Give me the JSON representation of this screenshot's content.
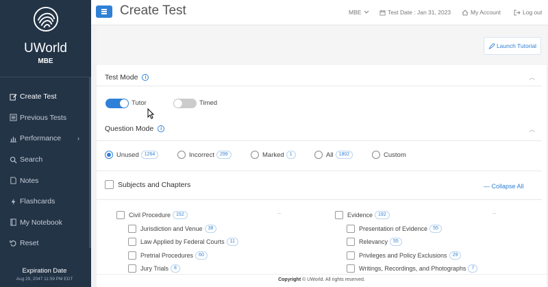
{
  "sidebar": {
    "brand": "UWorld",
    "subtitle": "MBE",
    "items": [
      {
        "label": "Create Test",
        "icon": "edit-icon"
      },
      {
        "label": "Previous Tests",
        "icon": "list-icon"
      },
      {
        "label": "Performance",
        "icon": "bar-chart-icon"
      },
      {
        "label": "Search",
        "icon": "search-icon"
      },
      {
        "label": "Notes",
        "icon": "note-icon"
      },
      {
        "label": "Flashcards",
        "icon": "bolt-icon"
      },
      {
        "label": "My Notebook",
        "icon": "notebook-icon"
      },
      {
        "label": "Reset",
        "icon": "reset-icon"
      }
    ],
    "expiration_label": "Expiration Date",
    "expiration_date": "Aug 29, 2047 11:59 PM EDT"
  },
  "header": {
    "title": "Create Test",
    "exam_select": "MBE",
    "test_date": "Test Date : Jan 31, 2023",
    "my_account": "My Account",
    "logout": "Log out"
  },
  "tutorial_button": "Launch Tutorial",
  "test_mode": {
    "title": "Test Mode",
    "tutor_label": "Tutor",
    "tutor_on": true,
    "timed_label": "Timed",
    "timed_on": false
  },
  "question_mode": {
    "title": "Question Mode",
    "options": [
      {
        "label": "Unused",
        "count": "1264",
        "selected": true
      },
      {
        "label": "Incorrect",
        "count": "299",
        "selected": false
      },
      {
        "label": "Marked",
        "count": "1",
        "selected": false
      },
      {
        "label": "All",
        "count": "1802",
        "selected": false
      },
      {
        "label": "Custom",
        "count": "",
        "selected": false
      }
    ]
  },
  "subjects": {
    "title": "Subjects and Chapters",
    "collapse_all": "Collapse All",
    "left": {
      "label": "Civil Procedure",
      "count": "152",
      "chapters": [
        {
          "label": "Jurisdiction and Venue",
          "count": "38"
        },
        {
          "label": "Law Applied by Federal Courts",
          "count": "11"
        },
        {
          "label": "Pretrial Procedures",
          "count": "60"
        },
        {
          "label": "Jury Trials",
          "count": "8"
        }
      ]
    },
    "right": {
      "label": "Evidence",
      "count": "192",
      "chapters": [
        {
          "label": "Presentation of Evidence",
          "count": "55"
        },
        {
          "label": "Relevancy",
          "count": "55"
        },
        {
          "label": "Privileges and Policy Exclusions",
          "count": "29"
        },
        {
          "label": "Writings, Recordings, and Photographs",
          "count": "7"
        }
      ]
    }
  },
  "footer": {
    "copyright_bold": "Copyright",
    "copyright_rest": "© UWorld. All rights reserved."
  },
  "colors": {
    "accent": "#2f80d6",
    "sidebar": "#243447"
  }
}
